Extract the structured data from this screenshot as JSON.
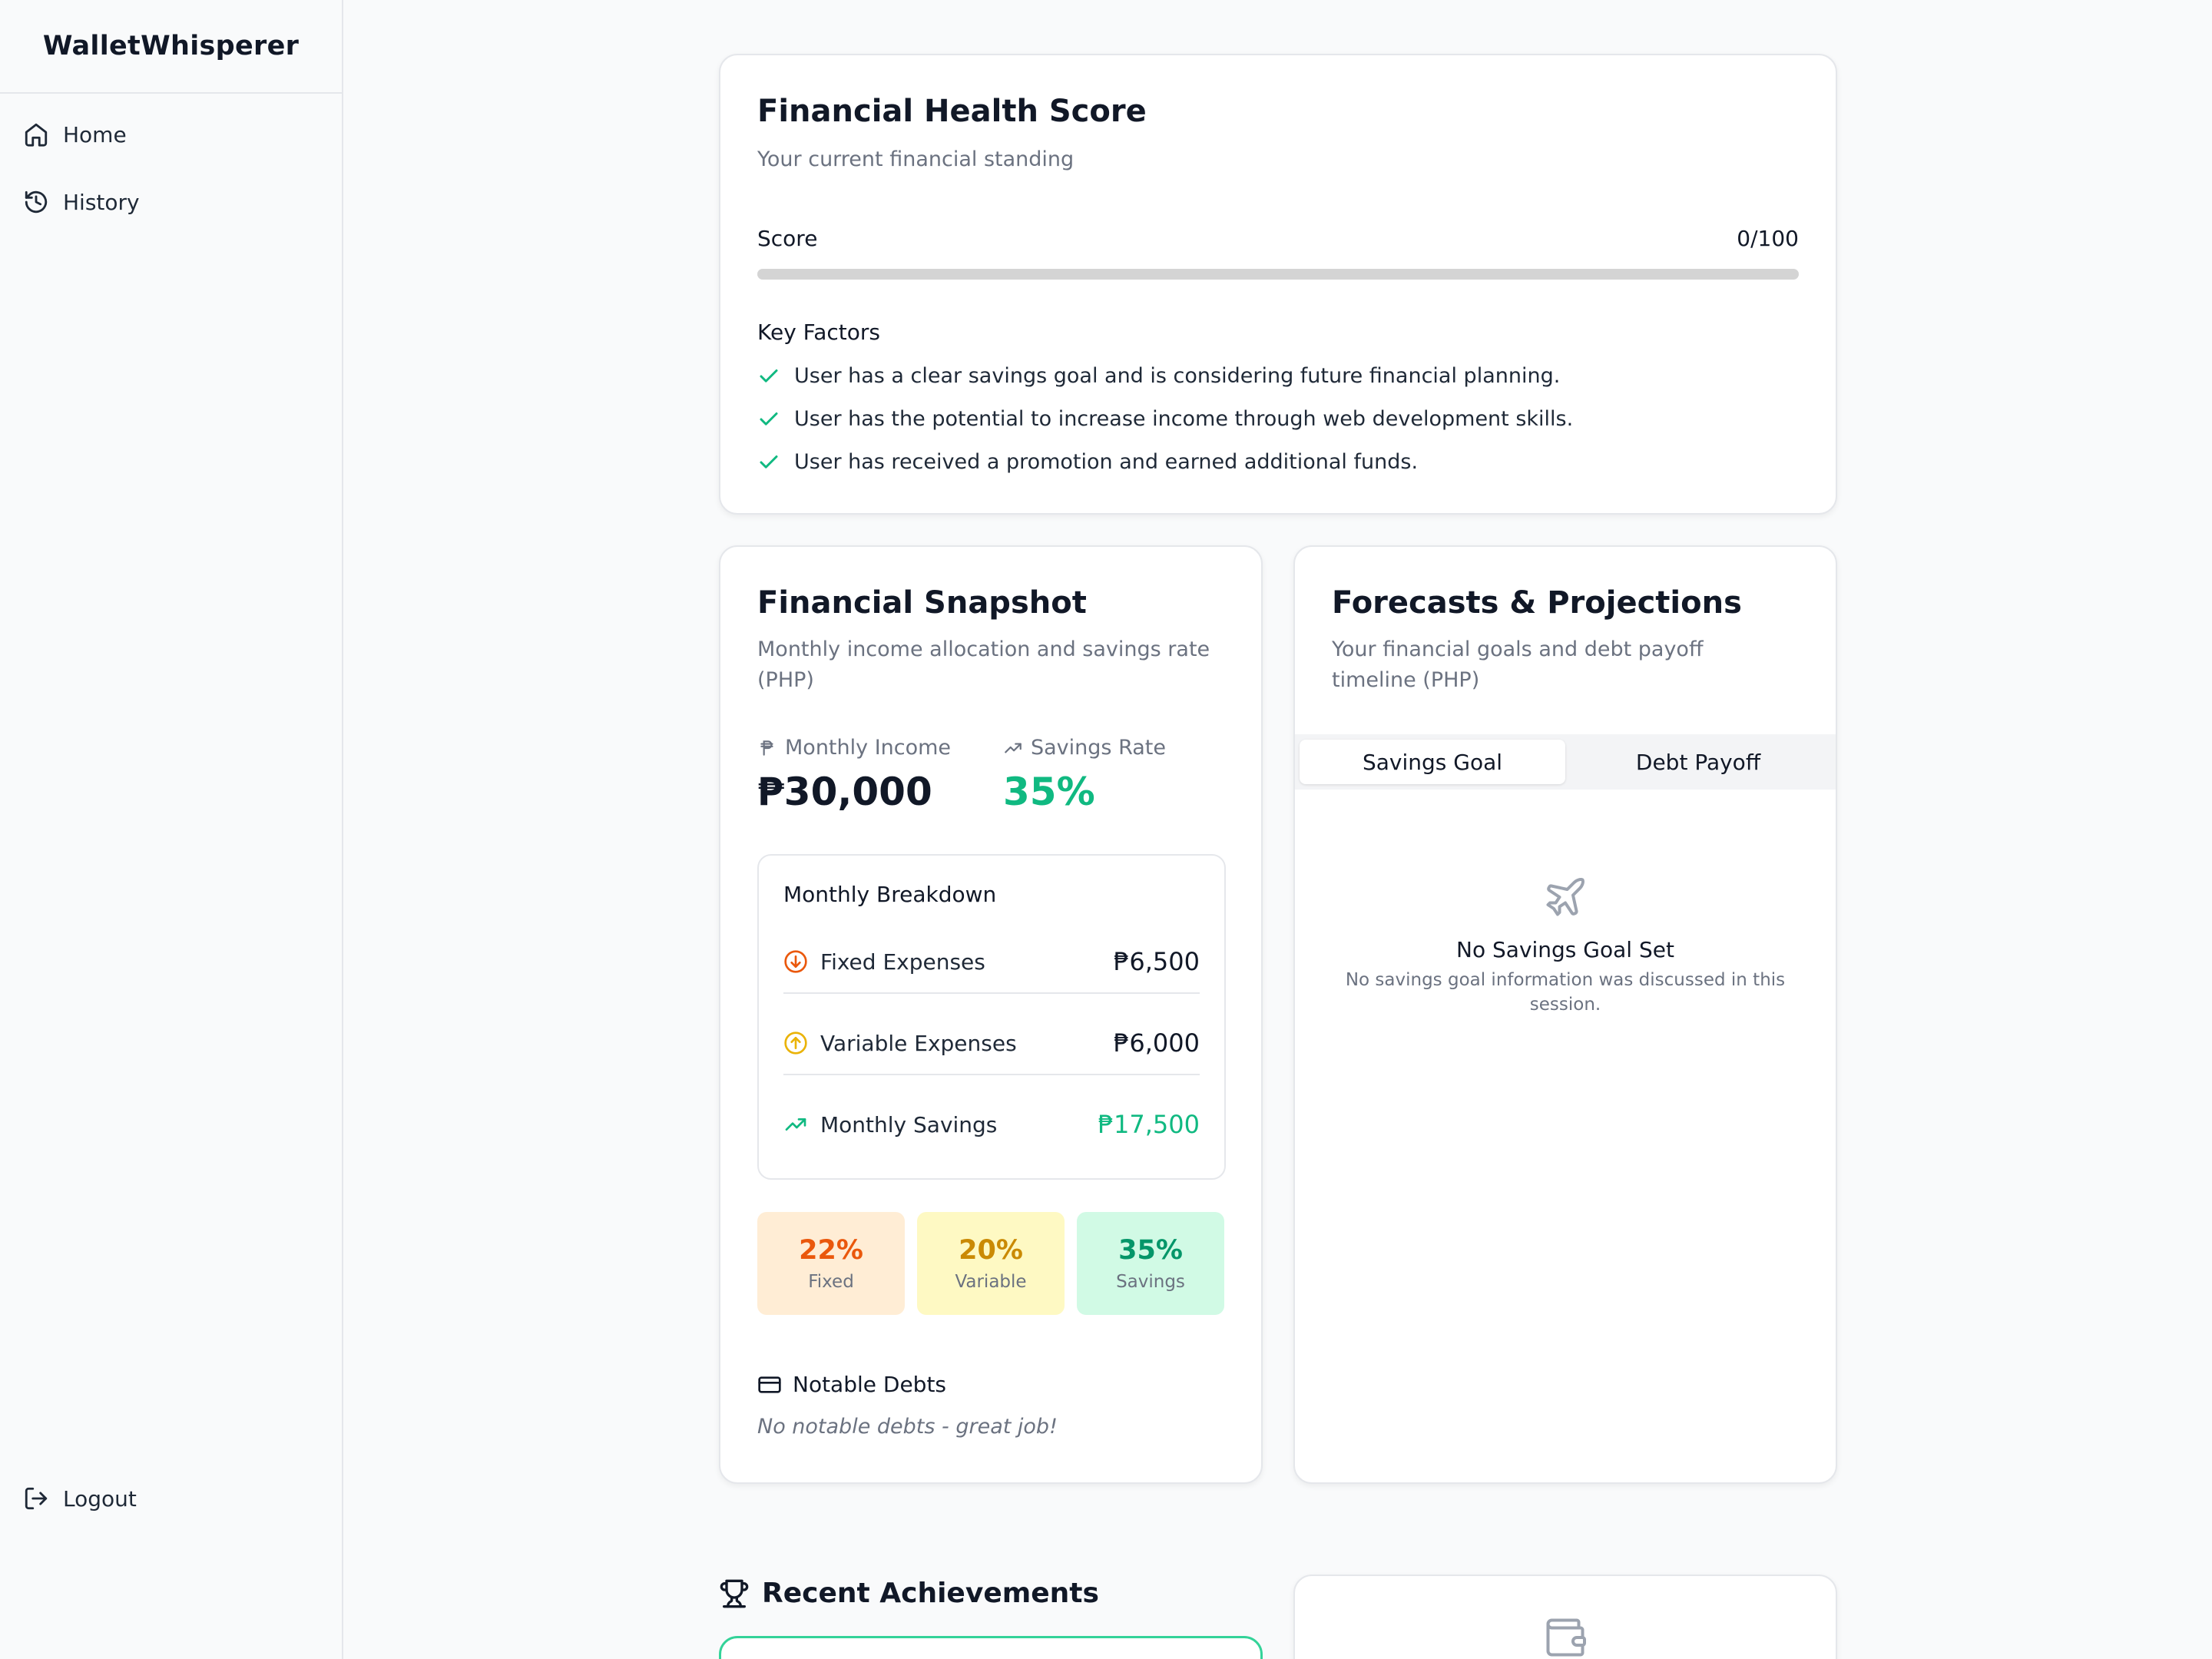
{
  "app": {
    "name": "WalletWhisperer"
  },
  "nav": {
    "home": "Home",
    "history": "History",
    "logout": "Logout"
  },
  "health": {
    "title": "Financial Health Score",
    "subtitle": "Your current financial standing",
    "score_label": "Score",
    "score_value": "0/100",
    "score_fraction": 0,
    "factors_title": "Key Factors",
    "factors": [
      "User has a clear savings goal and is considering future financial planning.",
      "User has the potential to increase income through web development skills.",
      "User has received a promotion and earned additional funds."
    ]
  },
  "snapshot": {
    "title": "Financial Snapshot",
    "subtitle": "Monthly income allocation and savings rate (PHP)",
    "income_label": "Monthly Income",
    "income_value": "₱30,000",
    "savings_rate_label": "Savings Rate",
    "savings_rate_value": "35%",
    "breakdown_title": "Monthly Breakdown",
    "rows": [
      {
        "label": "Fixed Expenses",
        "value": "₱6,500"
      },
      {
        "label": "Variable Expenses",
        "value": "₱6,000"
      },
      {
        "label": "Monthly Savings",
        "value": "₱17,500"
      }
    ],
    "pcts": [
      {
        "value": "22%",
        "label": "Fixed"
      },
      {
        "value": "20%",
        "label": "Variable"
      },
      {
        "value": "35%",
        "label": "Savings"
      }
    ],
    "debts_title": "Notable Debts",
    "debts_text": "No notable debts - great job!"
  },
  "forecast": {
    "title": "Forecasts & Projections",
    "subtitle": "Your financial goals and debt payoff timeline (PHP)",
    "tabs": [
      "Savings Goal",
      "Debt Payoff"
    ],
    "empty_title": "No Savings Goal Set",
    "empty_text": "No savings goal information was discussed in this session."
  },
  "achievements": {
    "title": "Recent Achievements"
  },
  "colors": {
    "green": "#10b981",
    "orange": "#ea580c",
    "amber": "#ca8a04",
    "fixed_bg": "#ffedd5",
    "variable_bg": "#fef9c3",
    "savings_bg": "#d1fae5"
  }
}
